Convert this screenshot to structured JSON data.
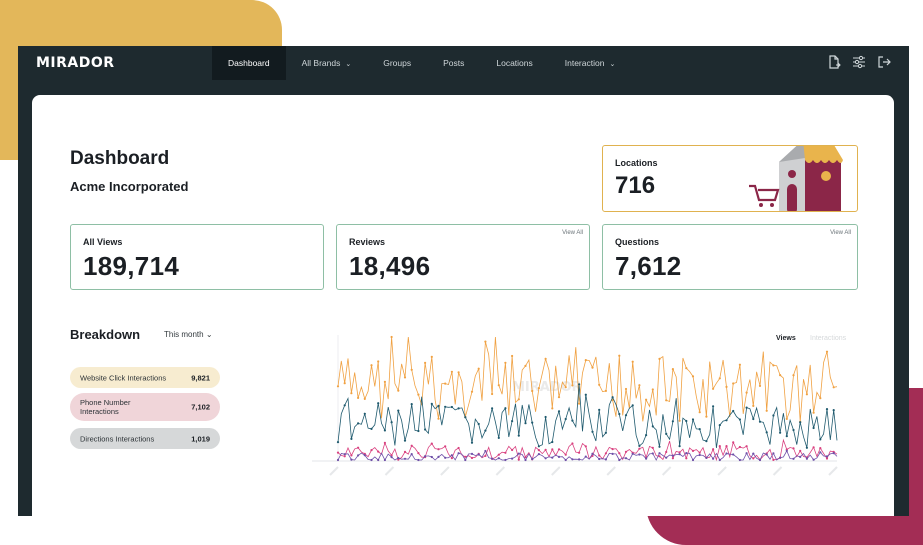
{
  "app": {
    "logo": "MIRADOR"
  },
  "nav": {
    "items": [
      {
        "label": "Dashboard",
        "active": true,
        "dropdown": false
      },
      {
        "label": "All Brands",
        "active": false,
        "dropdown": true
      },
      {
        "label": "Groups",
        "active": false,
        "dropdown": false
      },
      {
        "label": "Posts",
        "active": false,
        "dropdown": false
      },
      {
        "label": "Locations",
        "active": false,
        "dropdown": false
      },
      {
        "label": "Interaction",
        "active": false,
        "dropdown": true
      }
    ],
    "actions": [
      "export-icon",
      "filter-settings-icon",
      "logout-icon"
    ]
  },
  "page": {
    "title": "Dashboard",
    "subtitle": "Acme Incorporated"
  },
  "stats": {
    "locations": {
      "label": "Locations",
      "value": "716"
    },
    "views": {
      "label": "All Views",
      "value": "189,714"
    },
    "reviews": {
      "label": "Reviews",
      "value": "18,496",
      "link": "View All"
    },
    "questions": {
      "label": "Questions",
      "value": "7,612",
      "link": "View All"
    }
  },
  "breakdown": {
    "title": "Breakdown",
    "period": "This month",
    "items": [
      {
        "label": "Website Click Interactions",
        "value": "9,821",
        "color": "#f7ecd0"
      },
      {
        "label": "Phone Number Interactions",
        "value": "7,102",
        "color": "#f0d5d9"
      },
      {
        "label": "Directions Interactions",
        "value": "1,019",
        "color": "#d6d8d9"
      }
    ]
  },
  "chart": {
    "legend": [
      "Views",
      "Interactions"
    ],
    "watermark": "MIRADOR"
  },
  "colors": {
    "nav_bg": "#1e2a2f",
    "accent_yellow": "#e3b75a",
    "accent_maroon": "#a32d55",
    "card_border": "#8ebfa5",
    "series_orange": "#f0a142",
    "series_teal": "#1f5a6e",
    "series_pink": "#d9407f",
    "series_purple": "#6f4fa8"
  }
}
